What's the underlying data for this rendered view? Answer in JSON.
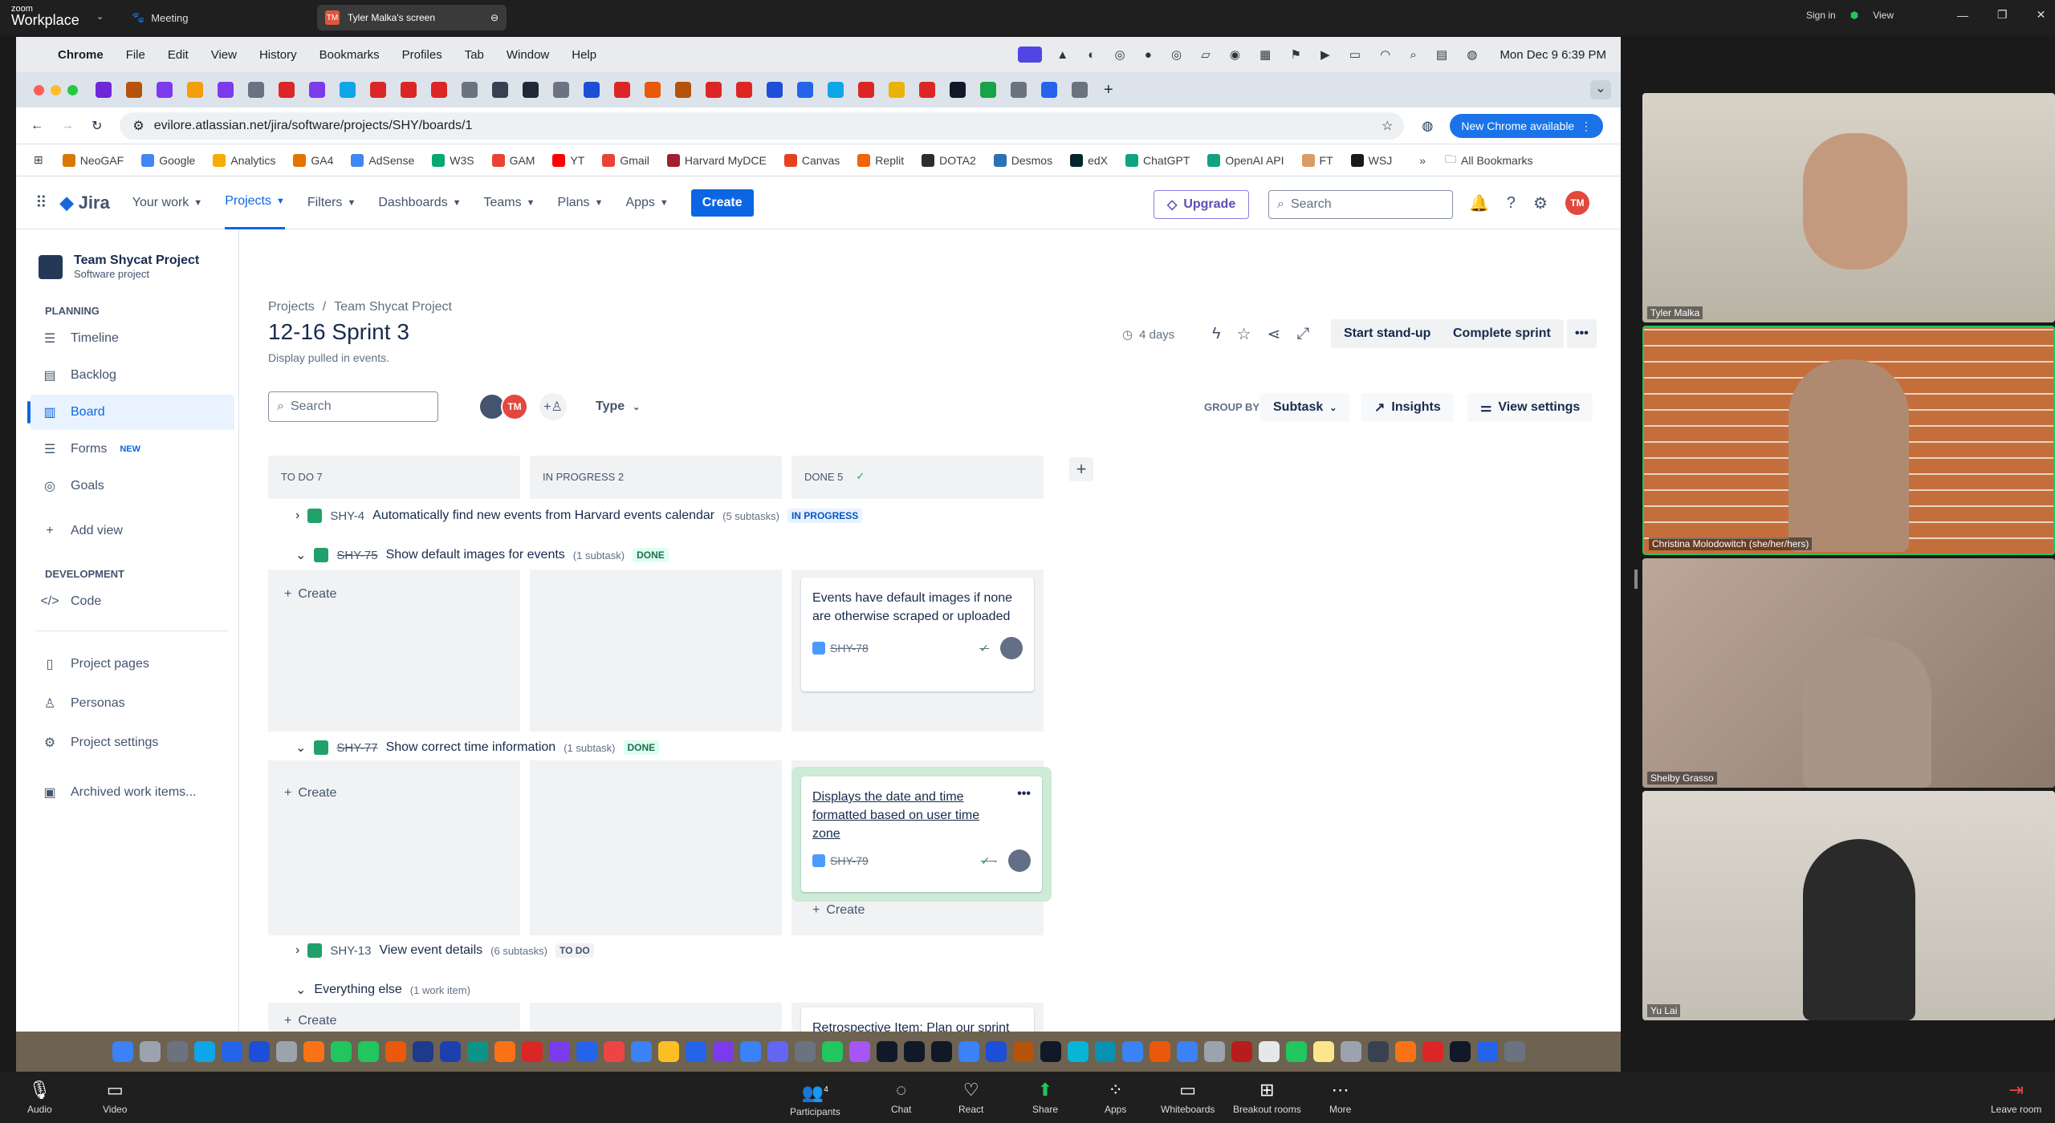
{
  "zoom": {
    "brand_top": "zoom",
    "brand": "Workplace",
    "meeting_label": "Meeting",
    "share_label": "Tyler Malka's screen",
    "share_avatar": "TM",
    "sign_in": "Sign in",
    "view": "View",
    "toolbar": {
      "audio": "Audio",
      "video": "Video",
      "participants": "Participants",
      "participants_count": "4",
      "chat": "Chat",
      "react": "React",
      "share": "Share",
      "apps": "Apps",
      "whiteboards": "Whiteboards",
      "breakout": "Breakout rooms",
      "more": "More",
      "leave": "Leave room"
    },
    "participants": [
      {
        "name": "Tyler Malka"
      },
      {
        "name": "Christina Molodowitch (she/her/hers)"
      },
      {
        "name": "Shelby Grasso"
      },
      {
        "name": "Yu Lai"
      }
    ]
  },
  "mac": {
    "menu": [
      "Chrome",
      "File",
      "Edit",
      "View",
      "History",
      "Bookmarks",
      "Profiles",
      "Tab",
      "Window",
      "Help"
    ],
    "clock": "Mon Dec 9  6:39 PM"
  },
  "browser": {
    "url": "evilore.atlassian.net/jira/software/projects/SHY/boards/1",
    "new_chrome": "New Chrome available",
    "bookmarks": [
      "NeoGAF",
      "Google",
      "Analytics",
      "GA4",
      "AdSense",
      "W3S",
      "GAM",
      "YT",
      "Gmail",
      "Harvard MyDCE",
      "Canvas",
      "Replit",
      "DOTA2",
      "Desmos",
      "edX",
      "ChatGPT",
      "OpenAI API",
      "FT",
      "WSJ"
    ],
    "all_bookmarks": "All Bookmarks"
  },
  "jira": {
    "logo": "Jira",
    "nav": [
      "Your work",
      "Projects",
      "Filters",
      "Dashboards",
      "Teams",
      "Plans",
      "Apps"
    ],
    "create": "Create",
    "upgrade": "Upgrade",
    "search_placeholder": "Search",
    "avatar": "TM",
    "sidebar": {
      "project_name": "Team Shycat Project",
      "project_type": "Software project",
      "planning_head": "PLANNING",
      "planning": [
        "Timeline",
        "Backlog",
        "Board",
        "Forms",
        "Goals",
        "Add view"
      ],
      "forms_tag": "NEW",
      "development_head": "DEVELOPMENT",
      "development": [
        "Code"
      ],
      "other": [
        "Project pages",
        "Personas",
        "Project settings",
        "Archived work items..."
      ]
    },
    "board": {
      "breadcrumb_root": "Projects",
      "breadcrumb_project": "Team Shycat Project",
      "title": "12-16 Sprint 3",
      "subtitle": "Display pulled in events.",
      "days": "4 days",
      "start_standup": "Start stand-up",
      "complete_sprint": "Complete sprint",
      "search_placeholder": "Search",
      "filter_avatar": "TM",
      "type_filter": "Type",
      "group_by_label": "GROUP BY",
      "group_by_value": "Subtask",
      "insights": "Insights",
      "view_settings": "View settings",
      "columns": [
        "TO DO 7",
        "IN PROGRESS 2",
        "DONE 5"
      ],
      "create_label": "Create",
      "groups": [
        {
          "key": "SHY-4",
          "title": "Automatically find new events from Harvard events calendar",
          "subtasks": "(5 subtasks)",
          "status": "IN PROGRESS"
        },
        {
          "key": "SHY-75",
          "title": "Show default images for events",
          "subtasks": "(1 subtask)",
          "status": "DONE"
        },
        {
          "key": "SHY-77",
          "title": "Show correct time information",
          "subtasks": "(1 subtask)",
          "status": "DONE"
        },
        {
          "key": "SHY-13",
          "title": "View event details",
          "subtasks": "(6 subtasks)",
          "status": "TO DO"
        },
        {
          "key": "",
          "title": "Everything else",
          "subtasks": "(1 work item)",
          "status": ""
        }
      ],
      "cards": [
        {
          "text": "Events have default images if none are otherwise scraped or uploaded",
          "key": "SHY-78"
        },
        {
          "text": "Displays the date and time formatted based on user time zone",
          "key": "SHY-79"
        },
        {
          "text": "Retrospective Item: Plan our sprint to be effective for pair",
          "key": ""
        }
      ]
    }
  }
}
